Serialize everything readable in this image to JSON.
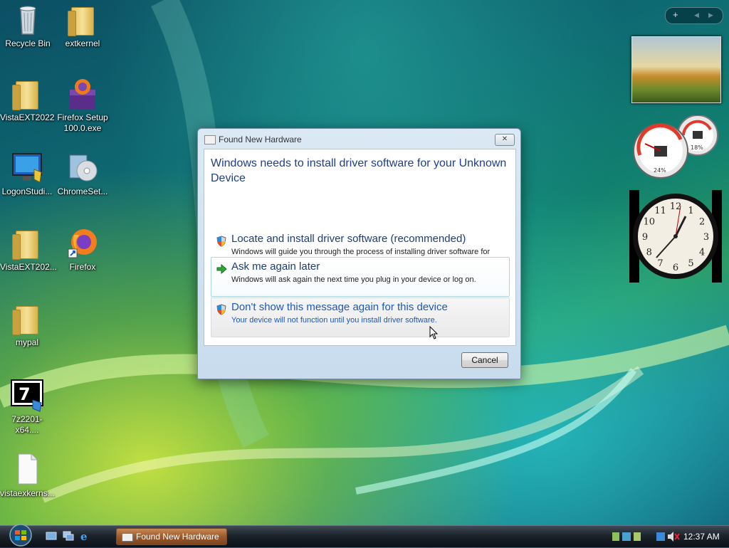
{
  "desktop": {
    "icons": [
      {
        "label": "Recycle Bin"
      },
      {
        "label": "extkernel"
      },
      {
        "label": "VistaEXT2022"
      },
      {
        "label": "Firefox Setup 100.0.exe"
      },
      {
        "label": "LogonStudi..."
      },
      {
        "label": "ChromeSet..."
      },
      {
        "label": "VistaEXT202..."
      },
      {
        "label": "Firefox"
      },
      {
        "label": "mypal"
      },
      {
        "label": "7z2201-x64...."
      },
      {
        "label": "vistaexkerns..."
      }
    ]
  },
  "gadgets": {
    "controls": {
      "add": "+",
      "prev": "◀",
      "next": "▶"
    },
    "cpu_meter": {
      "cpu_percent": "24%",
      "memory_percent": "18%"
    },
    "clock_numbers": [
      "12",
      "1",
      "2",
      "3",
      "4",
      "5",
      "6",
      "7",
      "8",
      "9",
      "10",
      "11"
    ]
  },
  "dialog": {
    "title": "Found New Hardware",
    "close_glyph": "✕",
    "heading": "Windows needs to install driver software for your Unknown Device",
    "options": [
      {
        "title": "Locate and install driver software (recommended)",
        "description": "Windows will guide you through the process of installing driver software for your device.",
        "icon": "shield-icon"
      },
      {
        "title": "Ask me again later",
        "description": "Windows will ask again the next time you plug in your device or log on.",
        "icon": "green-arrow-icon"
      },
      {
        "title": "Don't show this message again for this device",
        "description": "Your device will not function until you install driver software.",
        "icon": "shield-icon"
      }
    ],
    "cancel_label": "Cancel"
  },
  "taskbar": {
    "active_window": "Found New Hardware",
    "clock": "12:37 AM"
  }
}
